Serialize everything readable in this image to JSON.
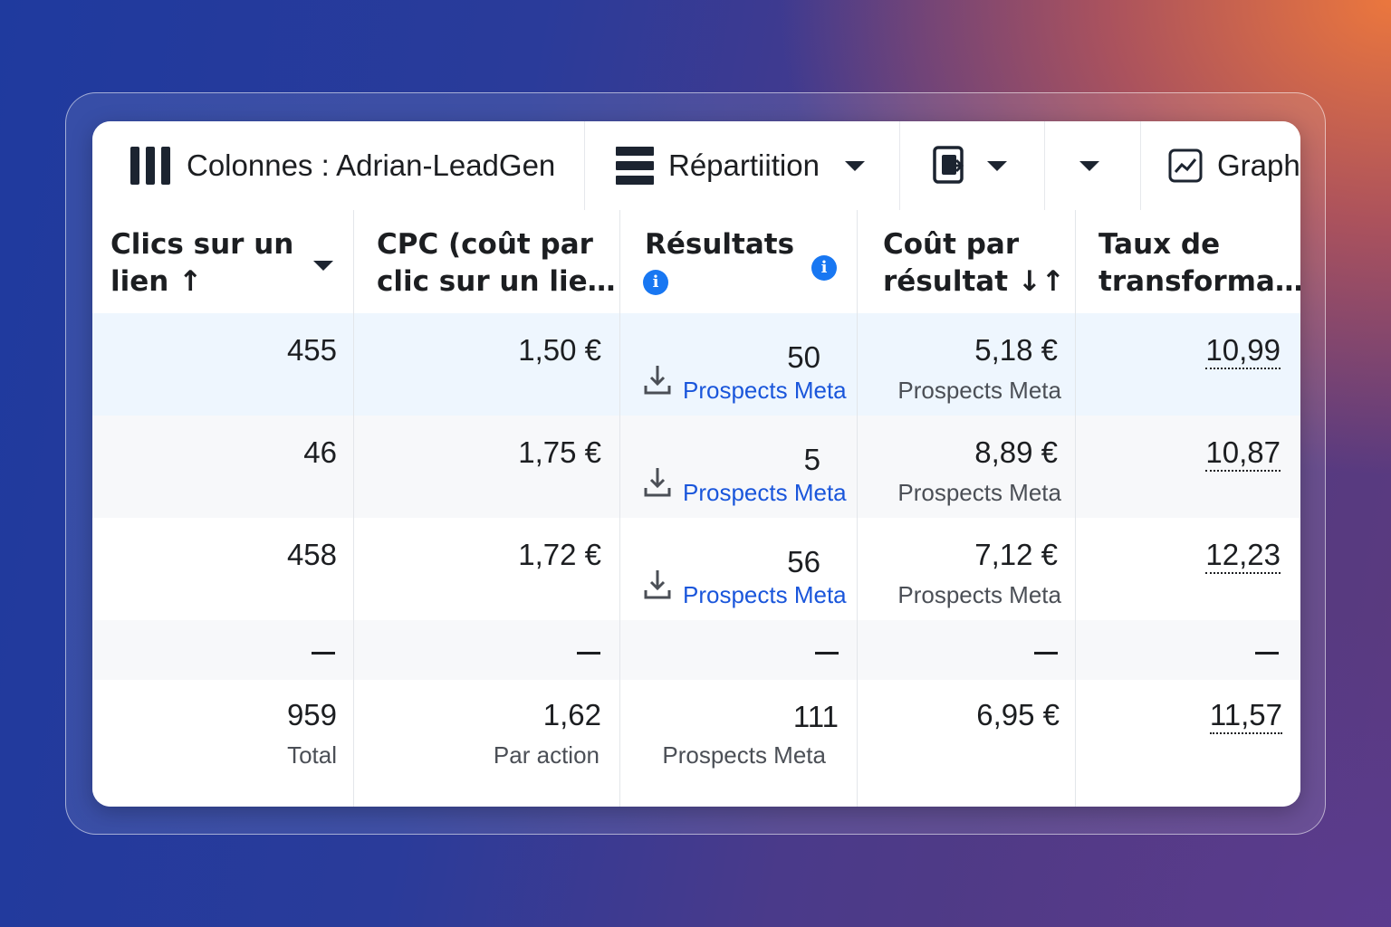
{
  "toolbar": {
    "columns_label": "Colonnes : Adrian-LeadGen",
    "breakdown_label": "Répartiition",
    "chart_label": "Graph"
  },
  "headers": {
    "col1": {
      "line1": "Clics sur un",
      "line2": "lien ↑"
    },
    "col2": {
      "line1": "CPC (coût par",
      "line2": "clic sur un lie…"
    },
    "col3": {
      "line1": "Résultats"
    },
    "col4": {
      "line1": "Coût par",
      "line2": "résultat ↓↑"
    },
    "col5": {
      "line1": "Taux de",
      "line2": "transforma…"
    }
  },
  "rows": [
    {
      "clicks": "455",
      "cpc": "1,50 €",
      "results": "50",
      "results_type": "Prospects Meta",
      "cost": "5,18 €",
      "cost_type": "Prospects Meta",
      "rate": "10,99"
    },
    {
      "clicks": "46",
      "cpc": "1,75 €",
      "results": "5",
      "results_type": "Prospects Meta",
      "cost": "8,89 €",
      "cost_type": "Prospects Meta",
      "rate": "10,87"
    },
    {
      "clicks": "458",
      "cpc": "1,72 €",
      "results": "56",
      "results_type": "Prospects Meta",
      "cost": "7,12 €",
      "cost_type": "Prospects Meta",
      "rate": "12,23"
    }
  ],
  "totals": {
    "clicks": "959",
    "clicks_sub": "Total",
    "cpc": "1,62",
    "cpc_sub": "Par action",
    "results": "111",
    "results_sub": "Prospects Meta",
    "cost": "6,95 €",
    "rate": "11,57"
  },
  "colors": {
    "highlight_row": "#eef6fe",
    "alt_row": "#f7f8fa",
    "link_blue": "#1a56db",
    "info_blue": "#1877f2"
  }
}
